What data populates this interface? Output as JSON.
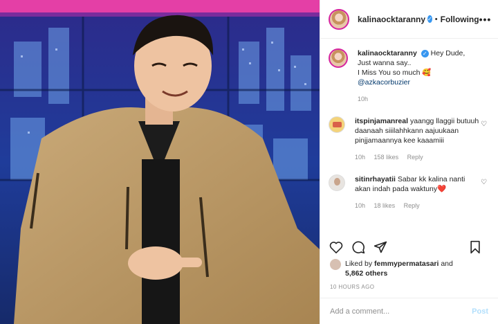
{
  "header": {
    "username": "kalinaocktaranny",
    "separator": "•",
    "follow_state": "Following",
    "more": "•••"
  },
  "caption": {
    "username": "kalinaocktaranny",
    "text_1": "Hey Dude,",
    "text_2": "Just wanna say..",
    "text_3": "I Miss You so much 🥰",
    "mention": "@azkacorbuzier",
    "time": "10h"
  },
  "comments": [
    {
      "username": "itspinjamanreal",
      "text": "yaangg llaggii butuuh daanaah siiilahhkann aajuukaan pinjjamaannya kee kaaamiii",
      "time": "10h",
      "likes": "158 likes",
      "reply": "Reply"
    },
    {
      "username": "sitinrhayatii",
      "text": "Sabar kk kalina nanti akan indah pada waktuny",
      "heart": "❤️",
      "time": "10h",
      "likes": "18 likes",
      "reply": "Reply"
    }
  ],
  "liked": {
    "prefix": "Liked by",
    "user": "femmypermatasari",
    "and": "and",
    "others": "5,862 others"
  },
  "posted_ago": "10 HOURS AGO",
  "add_comment": {
    "placeholder": "Add a comment...",
    "post_label": "Post"
  },
  "icons": {
    "verified": "✓",
    "heart_small": "♡"
  },
  "colors": {
    "verified_blue": "#3897f0",
    "link_blue": "#00376b",
    "post_disabled": "#b2dffc",
    "muted": "#8e8e8e"
  }
}
